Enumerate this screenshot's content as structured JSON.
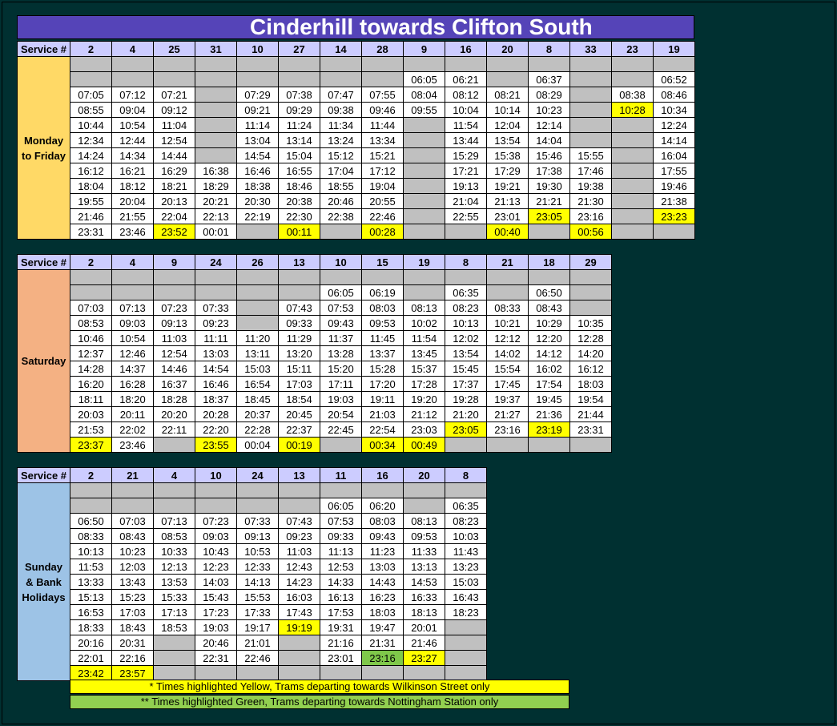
{
  "title": "Cinderhill towards Clifton South",
  "service_label": "Service #",
  "sections": [
    {
      "day_lines": [
        "Monday",
        "to Friday"
      ],
      "day_color": "#ffd966",
      "services": [
        "2",
        "4",
        "25",
        "31",
        "10",
        "27",
        "14",
        "28",
        "9",
        "16",
        "20",
        "8",
        "33",
        "23",
        "19"
      ],
      "rows": [
        [
          "",
          "",
          "",
          "",
          "",
          "",
          "",
          "",
          "",
          "",
          "",
          "",
          "",
          "",
          ""
        ],
        [
          "",
          "",
          "",
          "",
          "",
          "",
          "",
          "",
          "06:05",
          "06:21",
          "",
          "06:37",
          "",
          "",
          "06:52"
        ],
        [
          "07:05",
          "07:12",
          "07:21",
          "",
          "07:29",
          "07:38",
          "07:47",
          "07:55",
          "08:04",
          "08:12",
          "08:21",
          "08:29",
          "",
          "08:38",
          "08:46"
        ],
        [
          "08:55",
          "09:04",
          "09:12",
          "",
          "09:21",
          "09:29",
          "09:38",
          "09:46",
          "09:55",
          "10:04",
          "10:14",
          "10:23",
          "",
          "10:28",
          "10:34"
        ],
        [
          "10:44",
          "10:54",
          "11:04",
          "",
          "11:14",
          "11:24",
          "11:34",
          "11:44",
          "",
          "11:54",
          "12:04",
          "12:14",
          "",
          "",
          "12:24"
        ],
        [
          "12:34",
          "12:44",
          "12:54",
          "",
          "13:04",
          "13:14",
          "13:24",
          "13:34",
          "",
          "13:44",
          "13:54",
          "14:04",
          "",
          "",
          "14:14"
        ],
        [
          "14:24",
          "14:34",
          "14:44",
          "",
          "14:54",
          "15:04",
          "15:12",
          "15:21",
          "",
          "15:29",
          "15:38",
          "15:46",
          "15:55",
          "",
          "16:04"
        ],
        [
          "16:12",
          "16:21",
          "16:29",
          "16:38",
          "16:46",
          "16:55",
          "17:04",
          "17:12",
          "",
          "17:21",
          "17:29",
          "17:38",
          "17:46",
          "",
          "17:55"
        ],
        [
          "18:04",
          "18:12",
          "18:21",
          "18:29",
          "18:38",
          "18:46",
          "18:55",
          "19:04",
          "",
          "19:13",
          "19:21",
          "19:30",
          "19:38",
          "",
          "19:46"
        ],
        [
          "19:55",
          "20:04",
          "20:13",
          "20:21",
          "20:30",
          "20:38",
          "20:46",
          "20:55",
          "",
          "21:04",
          "21:13",
          "21:21",
          "21:30",
          "",
          "21:38"
        ],
        [
          "21:46",
          "21:55",
          "22:04",
          "22:13",
          "22:19",
          "22:30",
          "22:38",
          "22:46",
          "",
          "22:55",
          "23:01",
          "23:05",
          "23:16",
          "",
          "23:23"
        ],
        [
          "23:31",
          "23:46",
          "23:52",
          "00:01",
          "",
          "00:11",
          "",
          "00:28",
          "",
          "",
          "00:40",
          "",
          "00:56",
          "",
          ""
        ]
      ],
      "gray": [],
      "yellow": [
        "3-13",
        "10-11",
        "10-14",
        "11-2",
        "11-5",
        "11-7",
        "11-10",
        "11-12"
      ],
      "green": []
    },
    {
      "day_lines": [
        "Saturday"
      ],
      "day_color": "#f4b183",
      "services": [
        "2",
        "4",
        "9",
        "24",
        "26",
        "13",
        "10",
        "15",
        "19",
        "8",
        "21",
        "18",
        "29"
      ],
      "rows": [
        [
          "",
          "",
          "",
          "",
          "",
          "",
          "",
          "",
          "",
          "",
          "",
          "",
          ""
        ],
        [
          "",
          "",
          "",
          "",
          "",
          "",
          "06:05",
          "06:19",
          "",
          "06:35",
          "",
          "06:50",
          ""
        ],
        [
          "07:03",
          "07:13",
          "07:23",
          "07:33",
          "",
          "07:43",
          "07:53",
          "08:03",
          "08:13",
          "08:23",
          "08:33",
          "08:43",
          ""
        ],
        [
          "08:53",
          "09:03",
          "09:13",
          "09:23",
          "",
          "09:33",
          "09:43",
          "09:53",
          "10:02",
          "10:13",
          "10:21",
          "10:29",
          "10:35"
        ],
        [
          "10:46",
          "10:54",
          "11:03",
          "11:11",
          "11:20",
          "11:29",
          "11:37",
          "11:45",
          "11:54",
          "12:02",
          "12:12",
          "12:20",
          "12:28"
        ],
        [
          "12:37",
          "12:46",
          "12:54",
          "13:03",
          "13:11",
          "13:20",
          "13:28",
          "13:37",
          "13:45",
          "13:54",
          "14:02",
          "14:12",
          "14:20"
        ],
        [
          "14:28",
          "14:37",
          "14:46",
          "14:54",
          "15:03",
          "15:11",
          "15:20",
          "15:28",
          "15:37",
          "15:45",
          "15:54",
          "16:02",
          "16:12"
        ],
        [
          "16:20",
          "16:28",
          "16:37",
          "16:46",
          "16:54",
          "17:03",
          "17:11",
          "17:20",
          "17:28",
          "17:37",
          "17:45",
          "17:54",
          "18:03"
        ],
        [
          "18:11",
          "18:20",
          "18:28",
          "18:37",
          "18:45",
          "18:54",
          "19:03",
          "19:11",
          "19:20",
          "19:28",
          "19:37",
          "19:45",
          "19:54"
        ],
        [
          "20:03",
          "20:11",
          "20:20",
          "20:28",
          "20:37",
          "20:45",
          "20:54",
          "21:03",
          "21:12",
          "21:20",
          "21:27",
          "21:36",
          "21:44"
        ],
        [
          "21:53",
          "22:02",
          "22:11",
          "22:20",
          "22:28",
          "22:37",
          "22:45",
          "22:54",
          "23:03",
          "23:05",
          "23:16",
          "23:19",
          "23:31"
        ],
        [
          "23:37",
          "23:46",
          "",
          "23:55",
          "00:04",
          "00:19",
          "",
          "00:34",
          "00:49",
          "",
          "",
          "",
          ""
        ]
      ],
      "gray": [],
      "yellow": [
        "10-9",
        "10-11",
        "11-0",
        "11-3",
        "11-5",
        "11-7",
        "11-8"
      ],
      "green": []
    },
    {
      "day_lines": [
        "Sunday",
        "& Bank",
        "Holidays"
      ],
      "day_color": "#9dc3e6",
      "services": [
        "2",
        "21",
        "4",
        "10",
        "24",
        "13",
        "11",
        "16",
        "20",
        "8"
      ],
      "rows": [
        [
          "",
          "",
          "",
          "",
          "",
          "",
          "",
          "",
          "",
          ""
        ],
        [
          "",
          "",
          "",
          "",
          "",
          "",
          "06:05",
          "06:20",
          "",
          "06:35"
        ],
        [
          "06:50",
          "07:03",
          "07:13",
          "07:23",
          "07:33",
          "07:43",
          "07:53",
          "08:03",
          "08:13",
          "08:23"
        ],
        [
          "08:33",
          "08:43",
          "08:53",
          "09:03",
          "09:13",
          "09:23",
          "09:33",
          "09:43",
          "09:53",
          "10:03"
        ],
        [
          "10:13",
          "10:23",
          "10:33",
          "10:43",
          "10:53",
          "11:03",
          "11:13",
          "11:23",
          "11:33",
          "11:43"
        ],
        [
          "11:53",
          "12:03",
          "12:13",
          "12:23",
          "12:33",
          "12:43",
          "12:53",
          "13:03",
          "13:13",
          "13:23"
        ],
        [
          "13:33",
          "13:43",
          "13:53",
          "14:03",
          "14:13",
          "14:23",
          "14:33",
          "14:43",
          "14:53",
          "15:03"
        ],
        [
          "15:13",
          "15:23",
          "15:33",
          "15:43",
          "15:53",
          "16:03",
          "16:13",
          "16:23",
          "16:33",
          "16:43"
        ],
        [
          "16:53",
          "17:03",
          "17:13",
          "17:23",
          "17:33",
          "17:43",
          "17:53",
          "18:03",
          "18:13",
          "18:23"
        ],
        [
          "18:33",
          "18:43",
          "18:53",
          "19:03",
          "19:17",
          "19:19",
          "19:31",
          "19:47",
          "20:01",
          ""
        ],
        [
          "20:16",
          "20:31",
          "",
          "20:46",
          "21:01",
          "",
          "21:16",
          "21:31",
          "21:46",
          ""
        ],
        [
          "22:01",
          "22:16",
          "",
          "22:31",
          "22:46",
          "",
          "23:01",
          "23:16",
          "23:27",
          ""
        ],
        [
          "23:42",
          "23:57",
          "",
          "",
          "",
          "",
          "",
          "",
          "",
          ""
        ]
      ],
      "gray": [],
      "yellow": [
        "9-5",
        "11-8",
        "12-0",
        "12-1"
      ],
      "green": [
        "11-7"
      ]
    }
  ],
  "notes": [
    {
      "text": "* Times highlighted Yellow, Trams departing towards Wilkinson Street only",
      "color": "#ffff00"
    },
    {
      "text": "** Times highlighted Green, Trams departing towards Nottingham Station only",
      "color": "#92d050"
    }
  ]
}
